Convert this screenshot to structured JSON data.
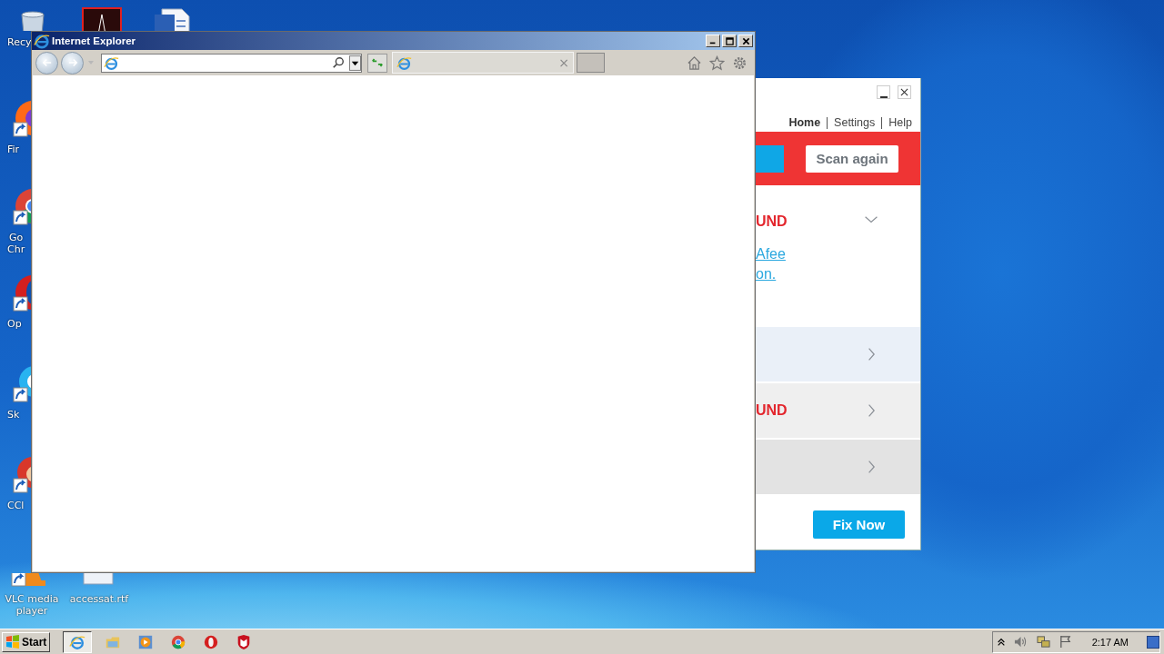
{
  "desktop": {
    "icons": [
      {
        "kind": "recycle",
        "lines": [
          "Recy"
        ]
      },
      {
        "kind": "pdf"
      },
      {
        "kind": "word"
      },
      {
        "kind": "firefox",
        "lines": [
          "Fir"
        ]
      },
      {
        "kind": "chrome",
        "lines": [
          "Go",
          "Chr"
        ]
      },
      {
        "kind": "opera",
        "lines": [
          "Op"
        ]
      },
      {
        "kind": "skype",
        "lines": [
          "Sk"
        ]
      },
      {
        "kind": "ccleaner",
        "lines": [
          "CCl"
        ]
      },
      {
        "kind": "vlc",
        "lines": [
          "VLC media",
          "player"
        ]
      },
      {
        "kind": "document",
        "lines": [
          "accessat.rtf"
        ]
      }
    ]
  },
  "browser_window": {
    "title": "Internet Explorer",
    "tab_close": "×"
  },
  "security_window": {
    "nav": [
      {
        "label": "Home",
        "selected": true
      },
      {
        "label": "Settings",
        "selected": false
      },
      {
        "label": "Help",
        "selected": false
      }
    ],
    "scan_button": "Scan again",
    "sections": [
      {
        "heading": "UND",
        "expanded": true,
        "links": [
          "Afee",
          "on."
        ]
      },
      {
        "expanded": false
      },
      {
        "heading": "UND",
        "expanded": false
      },
      {
        "expanded": false
      }
    ],
    "fix_button": "Fix Now"
  },
  "taskbar": {
    "start": "Start",
    "apps": [
      {
        "kind": "ie",
        "selected": true
      },
      {
        "kind": "folder",
        "selected": false
      },
      {
        "kind": "media",
        "selected": false
      },
      {
        "kind": "chrome",
        "selected": false
      },
      {
        "kind": "opera",
        "selected": false
      },
      {
        "kind": "shield",
        "selected": false
      }
    ],
    "clock": "2:17 AM"
  }
}
